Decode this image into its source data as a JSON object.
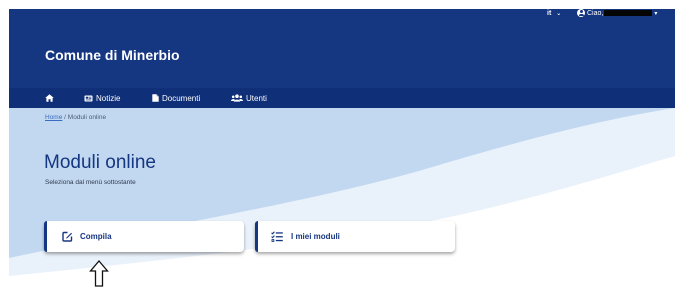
{
  "header": {
    "language": "it",
    "greeting": "Ciao,",
    "site_title": "Comune di Minerbio"
  },
  "nav": {
    "items": [
      {
        "label": ""
      },
      {
        "label": "Notizie"
      },
      {
        "label": "Documenti"
      },
      {
        "label": "Utenti"
      }
    ]
  },
  "breadcrumb": {
    "home": "Home",
    "separator": "/",
    "current": "Moduli online"
  },
  "page": {
    "title": "Moduli online",
    "subtitle": "Seleziona dal menù sottostante"
  },
  "cards": [
    {
      "label": "Compila",
      "icon": "edit-icon"
    },
    {
      "label": "I miei moduli",
      "icon": "checklist-icon"
    }
  ],
  "colors": {
    "header_bg": "#153680",
    "nav_bg": "#0f2f78",
    "hero_bg": "#c2d8f0",
    "accent": "#153680"
  }
}
